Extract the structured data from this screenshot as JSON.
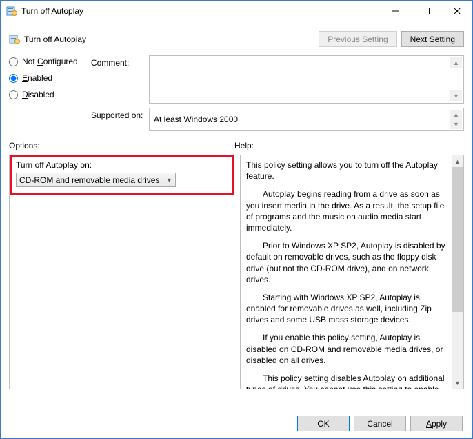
{
  "window": {
    "title": "Turn off Autoplay"
  },
  "header": {
    "policy_title": "Turn off Autoplay",
    "prev": "Previous Setting",
    "next_pre": "N",
    "next_rest": "ext Setting"
  },
  "radios": {
    "not_configured_pre": "Not ",
    "not_configured_u": "C",
    "not_configured_post": "onfigured",
    "enabled_u": "E",
    "enabled_post": "nabled",
    "disabled_u": "D",
    "disabled_post": "isabled",
    "selected": "enabled"
  },
  "labels": {
    "comment": "Comment:",
    "supported": "Supported on:",
    "options": "Options:",
    "help": "Help:"
  },
  "supported_text": "At least Windows 2000",
  "options": {
    "field_label": "Turn off Autoplay on:",
    "selected": "CD-ROM and removable media drives"
  },
  "help": {
    "p1": "This policy setting allows you to turn off the Autoplay feature.",
    "p2": "Autoplay begins reading from a drive as soon as you insert media in the drive. As a result, the setup file of programs and the music on audio media start immediately.",
    "p3": "Prior to Windows XP SP2, Autoplay is disabled by default on removable drives, such as the floppy disk drive (but not the CD-ROM drive), and on network drives.",
    "p4": "Starting with Windows XP SP2, Autoplay is enabled for removable drives as well, including Zip drives and some USB mass storage devices.",
    "p5": "If you enable this policy setting, Autoplay is disabled on CD-ROM and removable media drives, or disabled on all drives.",
    "p6": "This policy setting disables Autoplay on additional types of drives. You cannot use this setting to enable Autoplay on drives on which it is disabled by default."
  },
  "footer": {
    "ok": "OK",
    "cancel": "Cancel",
    "apply_u": "A",
    "apply_post": "pply"
  }
}
